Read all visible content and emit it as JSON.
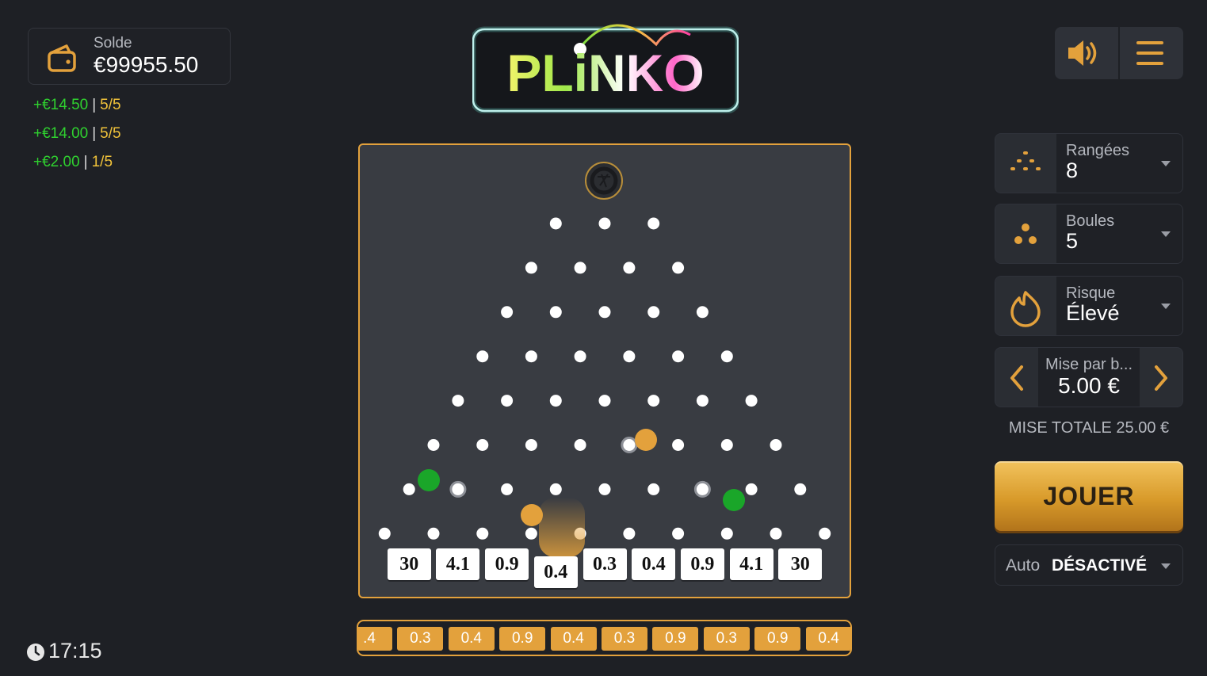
{
  "balance": {
    "label": "Solde",
    "value": "€99955.50"
  },
  "history": [
    {
      "amount": "+€14.50",
      "count": "5/5"
    },
    {
      "amount": "+€14.00",
      "count": "5/5"
    },
    {
      "amount": "+€2.00",
      "count": "1/5"
    }
  ],
  "logo": {
    "text": "PLiNKO"
  },
  "board": {
    "multipliers": [
      "30",
      "4.1",
      "0.9",
      "0.4",
      "0.3",
      "0.4",
      "0.9",
      "4.1",
      "30"
    ]
  },
  "recent_results": [
    ".4",
    "0.3",
    "0.4",
    "0.9",
    "0.4",
    "0.3",
    "0.9",
    "0.3",
    "0.9",
    "0.4"
  ],
  "clock": {
    "time": "17:15"
  },
  "settings": {
    "rows": {
      "label": "Rangées",
      "value": "8"
    },
    "balls": {
      "label": "Boules",
      "value": "5"
    },
    "risk": {
      "label": "Risque",
      "value": "Élevé"
    }
  },
  "stake": {
    "label": "Mise par b...",
    "value": "5.00 €"
  },
  "total_bet": "MISE TOTALE 25.00 €",
  "play_label": "JOUER",
  "auto": {
    "label": "Auto",
    "value": "DÉSACTIVÉ"
  },
  "colors": {
    "accent": "#e3a13c",
    "win_green": "#2fd12f",
    "count_yellow": "#f0c23a",
    "background": "#1e2025"
  }
}
